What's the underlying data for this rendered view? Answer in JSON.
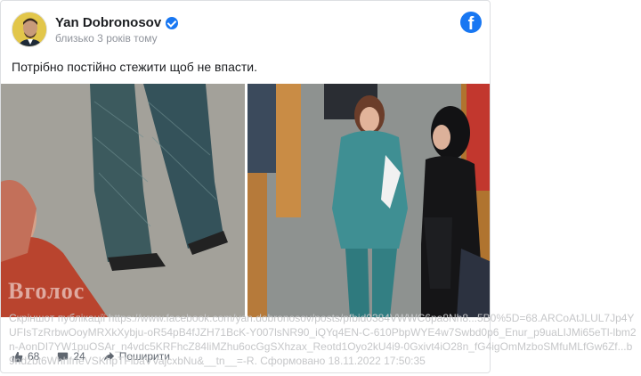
{
  "post": {
    "author": "Yan Dobronosov",
    "time": "близько 3 років тому",
    "text": "Потрібно постійно стежити щоб не впасти.",
    "watermark": "Вголос"
  },
  "actions": {
    "likes": "68",
    "comments": "24",
    "share": "Поширити"
  },
  "caption": "Скріншот публікації https://www.facebook.com/yan.dobronosov/posts/pfbid0384VWWC6pa8Nh8...5B0%5D=68.ARCoAtJLUL7Jp4YUFIsTzRrbwOoyMRXkXybju-oR54pB4fJZH71BcK-Y007lsNR90_iQYq4EN-C-610PbpWYE4w7Swbd0p6_Enur_p9uaLIJMi65eTl-lbm2n-AonDI7YW1puOSAr_n4vdc5KRFhcZ84liMZhu6ocGgSXhzax_Reotd1Oyo2kU4i9-0Gxivt4iO28n_fG4igOmMzboSMfuMLfGw6Zf...b9ndzbt6WhhfrfeVSKhpTFlbaVVajcxbNu&__tn__=-R. Сформовано 18.11.2022 17:50:35",
  "colors": {
    "brand": "#1877f2",
    "text": "#1c1e21",
    "muted": "#90949c"
  },
  "icons": [
    "verified-badge-icon",
    "facebook-logo-icon",
    "like-icon",
    "comment-icon",
    "share-icon"
  ]
}
